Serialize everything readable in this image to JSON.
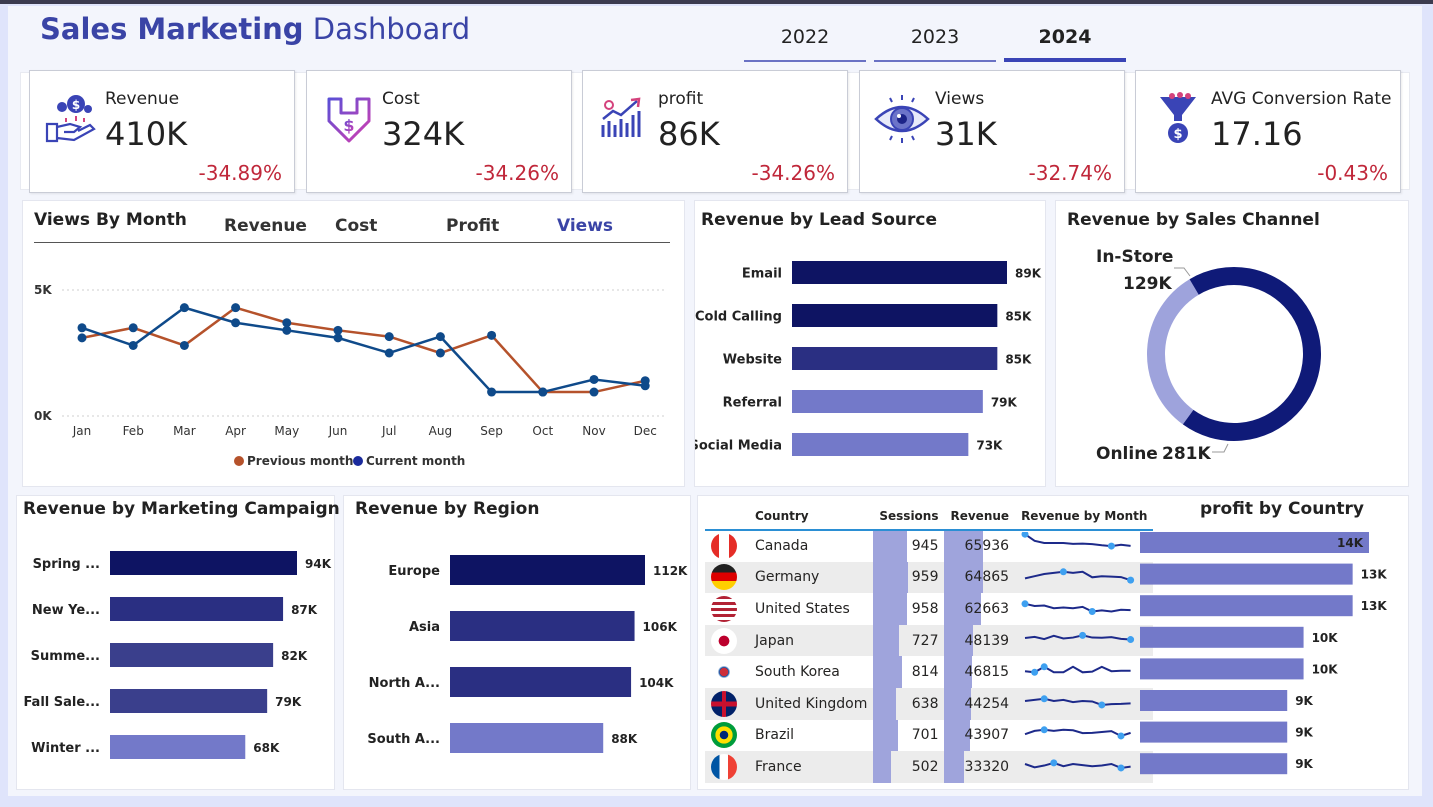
{
  "header": {
    "title_bold": "Sales Marketing",
    "title_light": "Dashboard"
  },
  "years": [
    {
      "label": "2022",
      "active": false
    },
    {
      "label": "2023",
      "active": false
    },
    {
      "label": "2024",
      "active": true
    }
  ],
  "kpis": [
    {
      "label": "Revenue",
      "value": "410K",
      "delta": "-34.89%",
      "icon": "revenue-icon"
    },
    {
      "label": "Cost",
      "value": "324K",
      "delta": "-34.26%",
      "icon": "cost-icon"
    },
    {
      "label": "profit",
      "value": "86K",
      "delta": "-34.26%",
      "icon": "profit-icon"
    },
    {
      "label": "Views",
      "value": "31K",
      "delta": "-32.74%",
      "icon": "views-icon"
    },
    {
      "label": "AVG Conversion Rate",
      "value": "17.16",
      "delta": "-0.43%",
      "icon": "conversion-icon"
    }
  ],
  "colors": {
    "dark_navy": "#0e1463",
    "mid_navy": "#2a2f82",
    "indigo": "#3a3f8c",
    "light_indigo": "#7379c9",
    "prev_line": "#b5522b",
    "curr_line": "#0f4a8a",
    "negative": "#c0273a",
    "donut_light": "#9ea3dc"
  },
  "views_panel": {
    "title": "Views By Month",
    "tabs": [
      {
        "label": "Revenue",
        "active": false
      },
      {
        "label": "Cost",
        "active": false
      },
      {
        "label": "Profit",
        "active": false
      },
      {
        "label": "Views",
        "active": true
      }
    ],
    "legend": [
      "Previous month",
      "Current month"
    ]
  },
  "lead_panel": {
    "title": "Revenue by Lead Source"
  },
  "channel_panel": {
    "title": "Revenue by Sales Channel"
  },
  "campaign_panel": {
    "title": "Revenue by Marketing Campaign"
  },
  "region_panel": {
    "title": "Revenue by Region"
  },
  "country_table": {
    "headers": [
      "Country",
      "Sessions",
      "Revenue",
      "Revenue by Month"
    ],
    "rows": [
      {
        "country": "Canada",
        "sessions": 945,
        "revenue": 65936,
        "flag": "flag-canada-icon"
      },
      {
        "country": "Germany",
        "sessions": 959,
        "revenue": 64865,
        "flag": "flag-germany-icon"
      },
      {
        "country": "United States",
        "sessions": 958,
        "revenue": 62663,
        "flag": "flag-us-icon"
      },
      {
        "country": "Japan",
        "sessions": 727,
        "revenue": 48139,
        "flag": "flag-japan-icon"
      },
      {
        "country": "South Korea",
        "sessions": 814,
        "revenue": 46815,
        "flag": "flag-korea-icon"
      },
      {
        "country": "United Kingdom",
        "sessions": 638,
        "revenue": 44254,
        "flag": "flag-uk-icon"
      },
      {
        "country": "Brazil",
        "sessions": 701,
        "revenue": 43907,
        "flag": "flag-brazil-icon"
      },
      {
        "country": "France",
        "sessions": 502,
        "revenue": 33320,
        "flag": "flag-france-icon"
      }
    ]
  },
  "profit_panel": {
    "title": "profit by Country"
  },
  "chart_data": [
    {
      "type": "line",
      "title": "Views By Month",
      "x": [
        "Jan",
        "Feb",
        "Mar",
        "Apr",
        "May",
        "Jun",
        "Jul",
        "Aug",
        "Sep",
        "Oct",
        "Nov",
        "Dec"
      ],
      "ylim": [
        0,
        5000
      ],
      "yticks": [
        "0K",
        "5K"
      ],
      "grid": true,
      "legend": "bottom",
      "series": [
        {
          "name": "Previous month",
          "values": [
            3100,
            3500,
            2800,
            4300,
            3700,
            3400,
            3150,
            2500,
            3200,
            950,
            950,
            1400
          ]
        },
        {
          "name": "Current month",
          "values": [
            3500,
            2800,
            4300,
            3700,
            3400,
            3100,
            2500,
            3150,
            950,
            950,
            1450,
            1200
          ]
        }
      ]
    },
    {
      "type": "bar",
      "title": "Revenue by Lead Source",
      "orientation": "horizontal",
      "categories": [
        "Email",
        "Cold Calling",
        "Website",
        "Referral",
        "Social Media"
      ],
      "values": [
        89,
        85,
        85,
        79,
        73
      ],
      "labels": [
        "89K",
        "85K",
        "85K",
        "79K",
        "73K"
      ]
    },
    {
      "type": "pie",
      "title": "Revenue by Sales Channel",
      "categories": [
        "In-Store",
        "Online"
      ],
      "values": [
        129,
        281
      ],
      "labels": [
        "129K",
        "281K"
      ]
    },
    {
      "type": "bar",
      "title": "Revenue by Marketing Campaign",
      "orientation": "horizontal",
      "categories": [
        "Spring ...",
        "New Ye...",
        "Summe...",
        "Fall Sale...",
        "Winter ..."
      ],
      "values": [
        94,
        87,
        82,
        79,
        68
      ],
      "labels": [
        "94K",
        "87K",
        "82K",
        "79K",
        "68K"
      ]
    },
    {
      "type": "bar",
      "title": "Revenue by Region",
      "orientation": "horizontal",
      "categories": [
        "Europe",
        "Asia",
        "North A...",
        "South A..."
      ],
      "values": [
        112,
        106,
        104,
        88
      ],
      "labels": [
        "112K",
        "106K",
        "104K",
        "88K"
      ]
    },
    {
      "type": "bar",
      "title": "profit by Country",
      "orientation": "horizontal",
      "categories": [
        "Canada",
        "Germany",
        "United States",
        "Japan",
        "South Korea",
        "United Kingdom",
        "Brazil",
        "France"
      ],
      "values": [
        14,
        13,
        13,
        10,
        10,
        9,
        9,
        9
      ],
      "labels": [
        "14K",
        "13K",
        "13K",
        "10K",
        "10K",
        "9K",
        "9K",
        "9K"
      ]
    }
  ]
}
